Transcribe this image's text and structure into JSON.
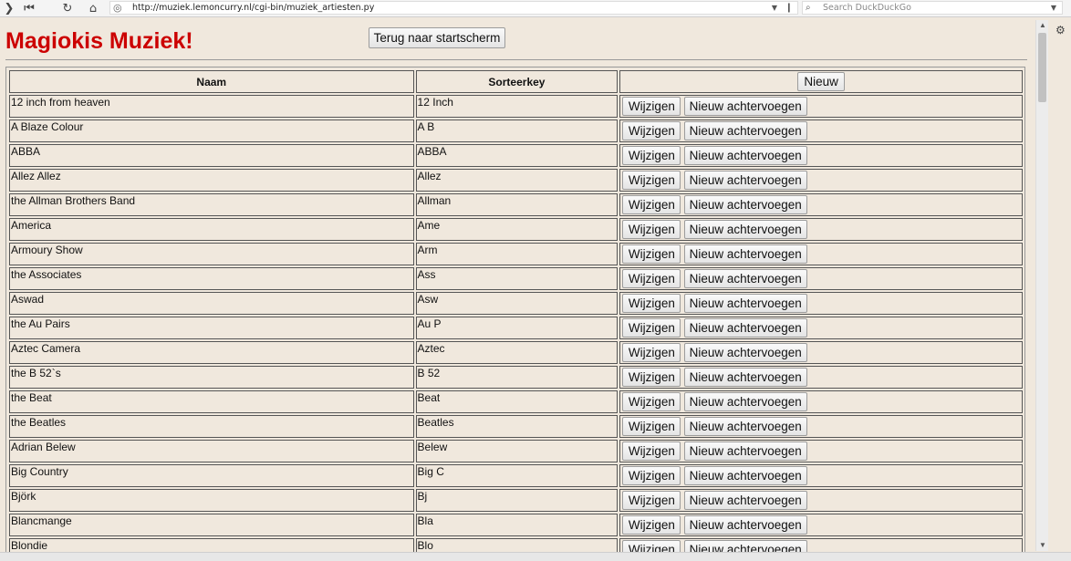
{
  "browser": {
    "url": "http://muziek.lemoncurry.nl/cgi-bin/muziek_artiesten.py",
    "search_placeholder": "Search DuckDuckGo"
  },
  "page": {
    "title": "Magiokis Muziek!",
    "home_button": "Terug naar startscherm"
  },
  "table": {
    "headers": {
      "naam": "Naam",
      "sorteerkey": "Sorteerkey"
    },
    "new_button": "Nieuw",
    "edit_button": "Wijzigen",
    "append_button": "Nieuw achtervoegen",
    "rows": [
      {
        "naam": "12 inch from heaven",
        "key": "12 Inch"
      },
      {
        "naam": "A Blaze Colour",
        "key": "A B"
      },
      {
        "naam": "ABBA",
        "key": "ABBA"
      },
      {
        "naam": "Allez Allez",
        "key": "Allez"
      },
      {
        "naam": "the Allman Brothers Band",
        "key": "Allman"
      },
      {
        "naam": "America",
        "key": "Ame"
      },
      {
        "naam": "Armoury Show",
        "key": "Arm"
      },
      {
        "naam": "the Associates",
        "key": "Ass"
      },
      {
        "naam": "Aswad",
        "key": "Asw"
      },
      {
        "naam": "the Au Pairs",
        "key": "Au P"
      },
      {
        "naam": "Aztec Camera",
        "key": "Aztec"
      },
      {
        "naam": "the B 52`s",
        "key": "B 52"
      },
      {
        "naam": "the Beat",
        "key": "Beat"
      },
      {
        "naam": "the Beatles",
        "key": "Beatles"
      },
      {
        "naam": "Adrian Belew",
        "key": "Belew"
      },
      {
        "naam": "Big Country",
        "key": "Big C"
      },
      {
        "naam": "Björk",
        "key": "Bj"
      },
      {
        "naam": "Blancmange",
        "key": "Bla"
      },
      {
        "naam": "Blondie",
        "key": "Blo"
      }
    ]
  }
}
